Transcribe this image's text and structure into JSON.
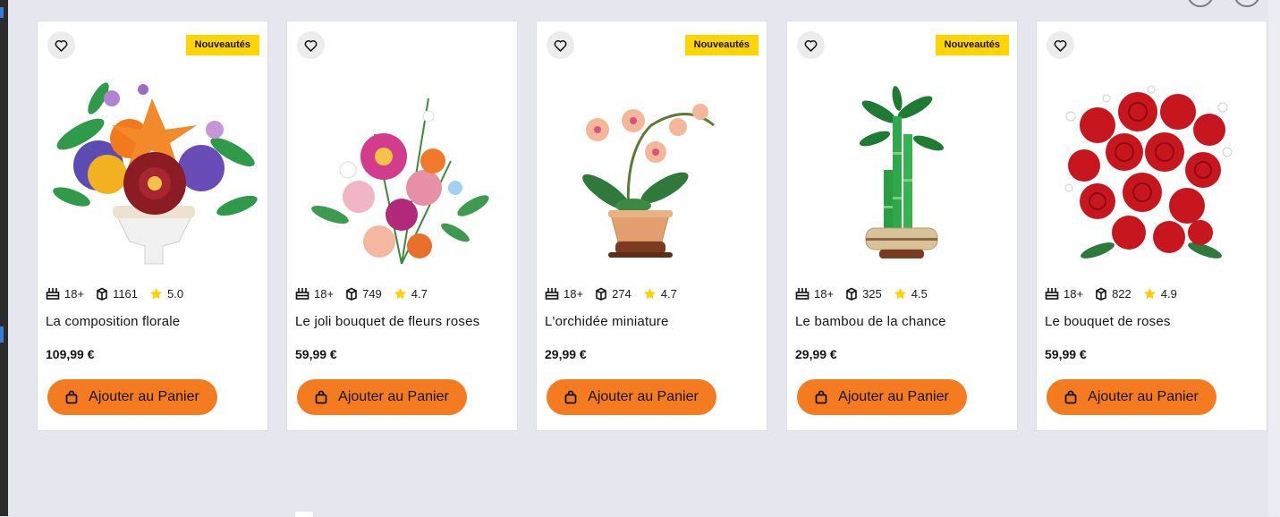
{
  "products": [
    {
      "badge": "Nouveautés",
      "age": "18+",
      "pieces": "1161",
      "rating": "5.0",
      "title": "La composition florale",
      "price": "109,99 €",
      "cta": "Ajouter au Panier"
    },
    {
      "badge": "",
      "age": "18+",
      "pieces": "749",
      "rating": "4.7",
      "title": "Le joli bouquet de fleurs roses",
      "price": "59,99 €",
      "cta": "Ajouter au Panier"
    },
    {
      "badge": "Nouveautés",
      "age": "18+",
      "pieces": "274",
      "rating": "4.7",
      "title": "L'orchidée miniature",
      "price": "29,99 €",
      "cta": "Ajouter au Panier"
    },
    {
      "badge": "Nouveautés",
      "age": "18+",
      "pieces": "325",
      "rating": "4.5",
      "title": "Le bambou de la chance",
      "price": "29,99 €",
      "cta": "Ajouter au Panier"
    },
    {
      "badge": "",
      "age": "18+",
      "pieces": "822",
      "rating": "4.9",
      "title": "Le bouquet de roses",
      "price": "59,99 €",
      "cta": "Ajouter au Panier"
    }
  ],
  "colors": {
    "accent": "#f47b20",
    "badge": "#ffd500",
    "star": "#ffcf00",
    "background": "#e6e6ee"
  },
  "icons": {
    "wishlist": "heart-icon",
    "age": "birthday-cake-icon",
    "pieces": "brick-icon",
    "rating": "star-icon",
    "cart": "shopping-bag-icon"
  }
}
